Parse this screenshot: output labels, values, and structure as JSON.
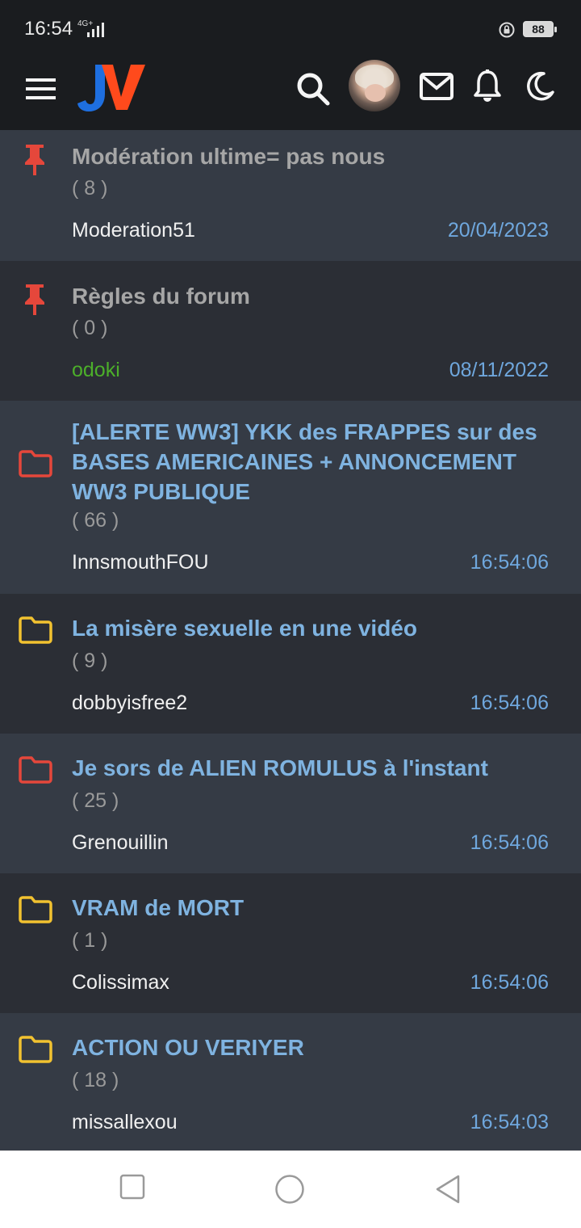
{
  "status": {
    "time": "16:54",
    "network": "4G+",
    "battery": "88"
  },
  "app": {
    "logo": "JV",
    "colors": {
      "accent_blue": "#1e6fe0",
      "accent_orange": "#ff4a1c",
      "link": "#7fb3e0",
      "pinned_icon": "#e5473b",
      "folder_hot": "#e5473b",
      "folder_normal": "#f2c230"
    }
  },
  "topics": [
    {
      "title": "Modération ultime= pas nous",
      "count": "( 8 )",
      "author": "Moderation51",
      "date": "20/04/2023",
      "icon": "pin-icon",
      "pinned": true
    },
    {
      "title": "Règles du forum",
      "count": "( 0 )",
      "author": "odoki",
      "date": "08/11/2022",
      "icon": "pin-icon",
      "pinned": true
    },
    {
      "title": "[ALERTE WW3] YKK des FRAPPES sur des BASES AMERICAINES + ANNONCEMENT WW3 PUBLIQUE",
      "count": "( 66 )",
      "author": "InnsmouthFOU",
      "date": "16:54:06",
      "icon": "folder-red-icon"
    },
    {
      "title": "La misère sexuelle en une vidéo",
      "count": "( 9 )",
      "author": "dobbyisfree2",
      "date": "16:54:06",
      "icon": "folder-yellow-icon"
    },
    {
      "title": "Je sors de ALIEN ROMULUS à l'instant",
      "count": "( 25 )",
      "author": "Grenouillin",
      "date": "16:54:06",
      "icon": "folder-red-icon"
    },
    {
      "title": "VRAM de MORT",
      "count": "( 1 )",
      "author": "Colissimax",
      "date": "16:54:06",
      "icon": "folder-yellow-icon"
    },
    {
      "title": "ACTION OU VERIYER",
      "count": "( 18 )",
      "author": "missallexou",
      "date": "16:54:03",
      "icon": "folder-yellow-icon"
    }
  ]
}
